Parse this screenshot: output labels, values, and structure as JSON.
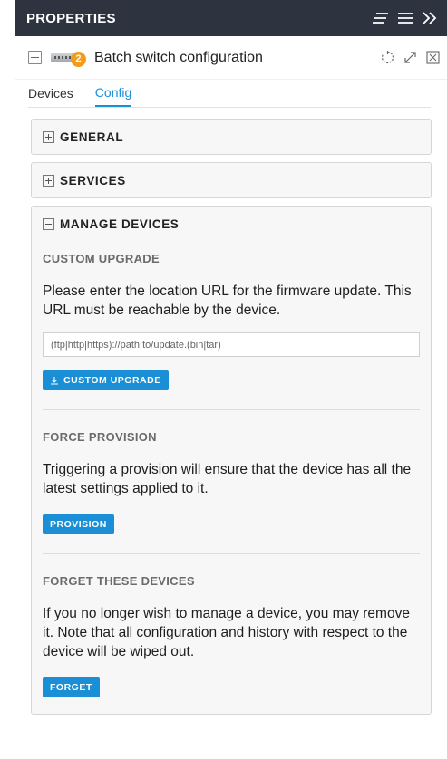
{
  "header": {
    "title": "PROPERTIES"
  },
  "device": {
    "title": "Batch switch configuration",
    "badge_count": "2"
  },
  "tabs": [
    {
      "label": "Devices"
    },
    {
      "label": "Config"
    }
  ],
  "sections": {
    "general": {
      "label": "GENERAL"
    },
    "services": {
      "label": "SERVICES"
    },
    "manage": {
      "label": "MANAGE DEVICES",
      "custom_upgrade": {
        "title": "CUSTOM UPGRADE",
        "description": "Please enter the location URL for the firmware update. This URL must be reachable by the device.",
        "placeholder": "(ftp|http|https)://path.to/update.(bin|tar)",
        "button": "CUSTOM UPGRADE"
      },
      "force_provision": {
        "title": "FORCE PROVISION",
        "description": "Triggering a provision will ensure that the device has all the latest settings applied to it.",
        "button": "PROVISION"
      },
      "forget": {
        "title": "FORGET THESE DEVICES",
        "description": "If you no longer wish to manage a device, you may remove it. Note that all configuration and history with respect to the device will be wiped out.",
        "button": "FORGET"
      }
    }
  },
  "colors": {
    "header_bg": "#2d3440",
    "accent": "#1a8fd6",
    "badge": "#f59b1a"
  }
}
